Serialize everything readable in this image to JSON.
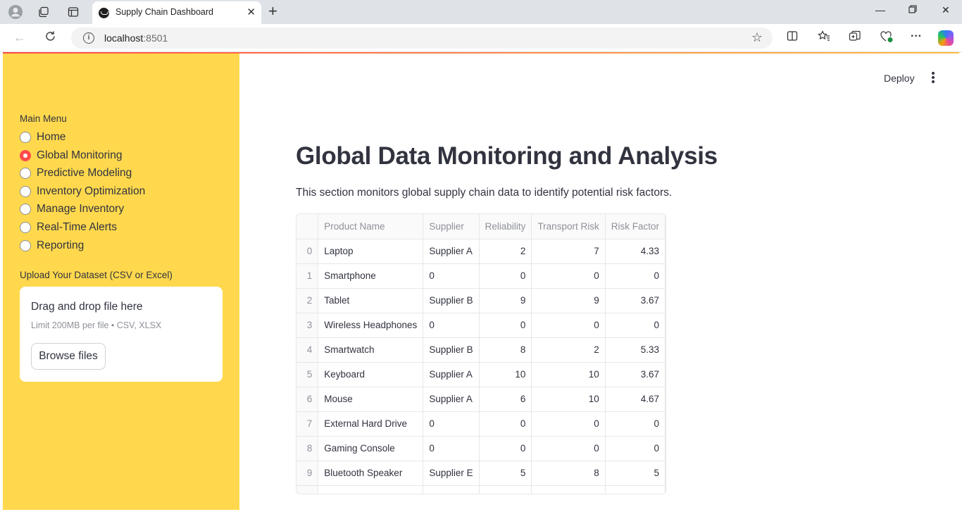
{
  "browser": {
    "tab_title": "Supply Chain Dashboard",
    "url_host": "localhost",
    "url_port": ":8501"
  },
  "app": {
    "deploy_label": "Deploy",
    "accent_color": "#ff4b4b",
    "sidebar_color": "#ffd84d"
  },
  "sidebar": {
    "menu_title": "Main Menu",
    "items": [
      {
        "label": "Home",
        "selected": false
      },
      {
        "label": "Global Monitoring",
        "selected": true
      },
      {
        "label": "Predictive Modeling",
        "selected": false
      },
      {
        "label": "Inventory Optimization",
        "selected": false
      },
      {
        "label": "Manage Inventory",
        "selected": false
      },
      {
        "label": "Real-Time Alerts",
        "selected": false
      },
      {
        "label": "Reporting",
        "selected": false
      }
    ],
    "upload_label": "Upload Your Dataset (CSV or Excel)",
    "dropzone_title": "Drag and drop file here",
    "dropzone_limit": "Limit 200MB per file • CSV, XLSX",
    "browse_label": "Browse files"
  },
  "main": {
    "title": "Global Data Monitoring and Analysis",
    "description": "This section monitors global supply chain data to identify potential risk factors.",
    "table": {
      "columns": [
        "",
        "Product Name",
        "Supplier",
        "Reliability",
        "Transport Risk",
        "Risk Factor"
      ],
      "rows": [
        [
          "0",
          "Laptop",
          "Supplier A",
          "2",
          "7",
          "4.33"
        ],
        [
          "1",
          "Smartphone",
          "0",
          "0",
          "0",
          "0"
        ],
        [
          "2",
          "Tablet",
          "Supplier B",
          "9",
          "9",
          "3.67"
        ],
        [
          "3",
          "Wireless Headphones",
          "0",
          "0",
          "0",
          "0"
        ],
        [
          "4",
          "Smartwatch",
          "Supplier B",
          "8",
          "2",
          "5.33"
        ],
        [
          "5",
          "Keyboard",
          "Supplier A",
          "10",
          "10",
          "3.67"
        ],
        [
          "6",
          "Mouse",
          "Supplier A",
          "6",
          "10",
          "4.67"
        ],
        [
          "7",
          "External Hard Drive",
          "0",
          "0",
          "0",
          "0"
        ],
        [
          "8",
          "Gaming Console",
          "0",
          "0",
          "0",
          "0"
        ],
        [
          "9",
          "Bluetooth Speaker",
          "Supplier E",
          "5",
          "8",
          "5"
        ],
        [
          "",
          "",
          "",
          "",
          "",
          ""
        ]
      ]
    }
  }
}
